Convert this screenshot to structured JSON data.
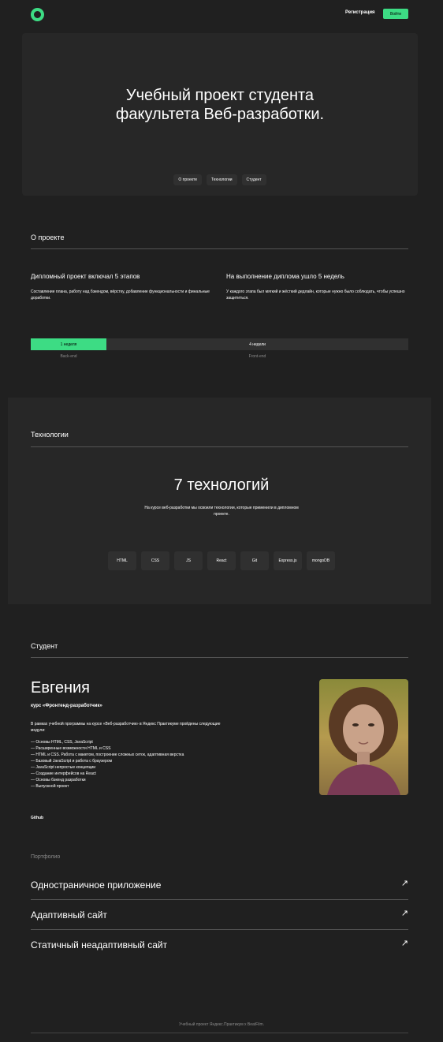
{
  "header": {
    "register_label": "Регистрация",
    "login_label": "Войти"
  },
  "hero": {
    "title": "Учебный проект студента\nфакультета Веб-разработки.",
    "nav": [
      "О проекте",
      "Технологии",
      "Студент"
    ]
  },
  "about": {
    "title": "О проекте",
    "col1": {
      "heading": "Дипломный проект включал 5 этапов",
      "text": "Составление плана, работу над бэкендом, вёрстку, добавление функциональности и финальные доработки."
    },
    "col2": {
      "heading": "На выполнение диплома ушло 5 недель",
      "text": "У каждого этапа был мягкий и жёсткий дедлайн, которые нужно было соблюдать, чтобы успешно защититься."
    },
    "timeline": {
      "backend_duration": "1 неделя",
      "frontend_duration": "4 недели",
      "backend_label": "Back-end",
      "frontend_label": "Front-end",
      "backend_share": 0.2
    }
  },
  "tech": {
    "title": "Технологии",
    "count": "7 технологий",
    "description": "На курсе веб-разработки мы освоили технологии, которые применили в дипломном проекте.",
    "items": [
      "HTML",
      "CSS",
      "JS",
      "React",
      "Git",
      "Express.js",
      "mongoDB"
    ]
  },
  "student": {
    "title": "Студент",
    "name": "Евгения",
    "job": "курс «Фронтенд-разработчик»",
    "about": "В рамках учебной программы на курсе «Веб-разработчик» в Яндекс Практикуме пройдены следующие модули:",
    "modules": [
      "— Основы HTML, CSS, JavaScript",
      "— Расширенные возможности HTML и CSS",
      "— HTML и CSS. Работа с макетом, построение сложных сеток, адаптивная верстка",
      "— Базовый JavaScript и работа с браузером",
      "— JavaScript непростые концепции",
      "— Создание интерфейсов на React",
      "— Основы бэкенд разработки",
      "— Выпускной проект"
    ],
    "github_label": "Github"
  },
  "portfolio": {
    "title": "Портфолио",
    "items": [
      {
        "label": "Одностраничное приложение",
        "arrow": "↗"
      },
      {
        "label": "Адаптивный сайт",
        "arrow": "↗"
      },
      {
        "label": "Статичный неадаптивный сайт",
        "arrow": "↗"
      }
    ]
  },
  "footer": {
    "text": "Учебный проект Яндекс.Практикум х BeatFilm."
  },
  "colors": {
    "accent": "#3ddc84",
    "background": "#202020",
    "panel": "#272727",
    "chip": "#303030"
  }
}
